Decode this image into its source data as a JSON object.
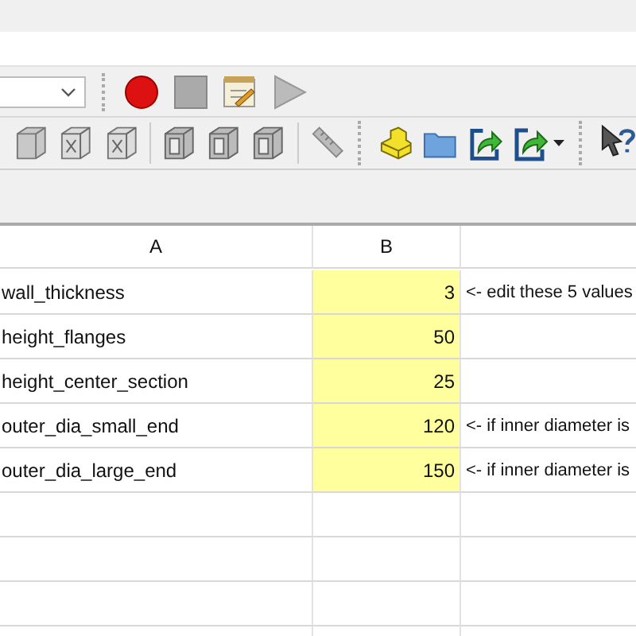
{
  "toolbar_1": [
    {
      "kind": "record"
    },
    {
      "kind": "stop"
    },
    {
      "kind": "edit-macro"
    },
    {
      "kind": "play"
    }
  ],
  "toolbar_2": [
    {
      "kind": "cube"
    },
    {
      "kind": "cube-x"
    },
    {
      "kind": "cube-x"
    },
    {
      "kind": "sep"
    },
    {
      "kind": "cube-wire"
    },
    {
      "kind": "cube-wire"
    },
    {
      "kind": "cube-wire"
    },
    {
      "kind": "sep"
    },
    {
      "kind": "ruler"
    },
    {
      "kind": "bar"
    },
    {
      "kind": "part"
    },
    {
      "kind": "folder"
    },
    {
      "kind": "link"
    },
    {
      "kind": "link-menu"
    },
    {
      "kind": "bar"
    },
    {
      "kind": "help"
    }
  ],
  "sheet": {
    "columns": [
      "A",
      "B"
    ],
    "rows": [
      {
        "name": "wall_thickness",
        "value": "3",
        "note": "<- edit these 5 values",
        "highlighted": true
      },
      {
        "name": "height_flanges",
        "value": "50",
        "highlighted": true
      },
      {
        "name": "height_center_section",
        "value": "25",
        "highlighted": true
      },
      {
        "name": "outer_dia_small_end",
        "value": "120",
        "note": "<- if inner diameter is",
        "highlighted": true
      },
      {
        "name": "outer_dia_large_end",
        "value": "150",
        "note": "<- if inner diameter is",
        "highlighted": true
      }
    ]
  }
}
